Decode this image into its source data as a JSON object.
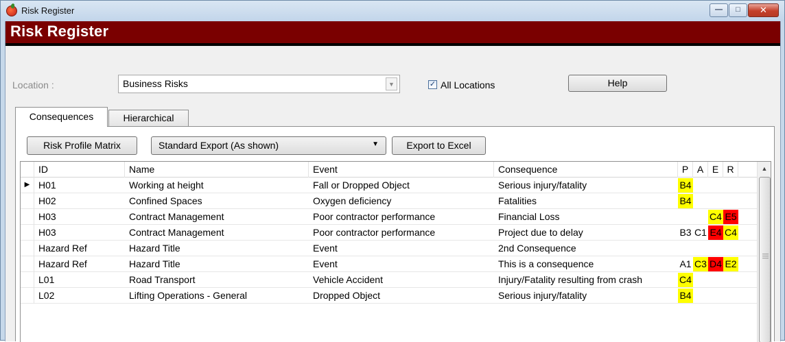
{
  "window": {
    "title": "Risk Register"
  },
  "header": {
    "title": "Risk Register"
  },
  "location": {
    "label": "Location :",
    "value": "Business Risks",
    "all_locations_label": "All Locations",
    "all_locations_checked": true
  },
  "help_label": "Help",
  "tabs": [
    {
      "label": "Consequences",
      "active": true
    },
    {
      "label": "Hierarchical",
      "active": false
    }
  ],
  "toolbar": {
    "matrix_label": "Risk Profile Matrix",
    "export_option": "Standard Export (As shown)",
    "export_label": "Export to Excel"
  },
  "colors": {
    "yellow": "#ffff00",
    "red": "#ff0000",
    "header_band": "#7a0000"
  },
  "grid": {
    "columns": [
      "ID",
      "Name",
      "Event",
      "Consequence",
      "P",
      "A",
      "E",
      "R"
    ],
    "rows": [
      {
        "id": "H01",
        "name": "Working at height",
        "event": "Fall or Dropped Object",
        "consequence": "Serious injury/fatality",
        "p": {
          "v": "B4",
          "c": "yellow"
        },
        "a": {
          "v": "",
          "c": ""
        },
        "e": {
          "v": "",
          "c": ""
        },
        "r": {
          "v": "",
          "c": ""
        },
        "current": true
      },
      {
        "id": "H02",
        "name": "Confined Spaces",
        "event": "Oxygen deficiency",
        "consequence": "Fatalities",
        "p": {
          "v": "B4",
          "c": "yellow"
        },
        "a": {
          "v": "",
          "c": ""
        },
        "e": {
          "v": "",
          "c": ""
        },
        "r": {
          "v": "",
          "c": ""
        }
      },
      {
        "id": "H03",
        "name": "Contract Management",
        "event": "Poor contractor performance",
        "consequence": "Financial Loss",
        "p": {
          "v": "",
          "c": ""
        },
        "a": {
          "v": "",
          "c": ""
        },
        "e": {
          "v": "C4",
          "c": "yellow"
        },
        "r": {
          "v": "E5",
          "c": "red"
        }
      },
      {
        "id": "H03",
        "name": "Contract Management",
        "event": "Poor contractor performance",
        "consequence": "Project due to delay",
        "p": {
          "v": "B3",
          "c": ""
        },
        "a": {
          "v": "C1",
          "c": ""
        },
        "e": {
          "v": "E4",
          "c": "red"
        },
        "r": {
          "v": "C4",
          "c": "yellow"
        }
      },
      {
        "id": "Hazard Ref",
        "name": "Hazard Title",
        "event": "Event",
        "consequence": "2nd Consequence",
        "p": {
          "v": "",
          "c": ""
        },
        "a": {
          "v": "",
          "c": ""
        },
        "e": {
          "v": "",
          "c": ""
        },
        "r": {
          "v": "",
          "c": ""
        }
      },
      {
        "id": "Hazard Ref",
        "name": "Hazard Title",
        "event": "Event",
        "consequence": "This is a consequence",
        "p": {
          "v": "A1",
          "c": ""
        },
        "a": {
          "v": "C3",
          "c": "yellow"
        },
        "e": {
          "v": "D4",
          "c": "red"
        },
        "r": {
          "v": "E2",
          "c": "yellow"
        }
      },
      {
        "id": "L01",
        "name": "Road Transport",
        "event": "Vehicle Accident",
        "consequence": "Injury/Fatality resulting from crash",
        "p": {
          "v": "C4",
          "c": "yellow"
        },
        "a": {
          "v": "",
          "c": ""
        },
        "e": {
          "v": "",
          "c": ""
        },
        "r": {
          "v": "",
          "c": ""
        }
      },
      {
        "id": "L02",
        "name": "Lifting Operations - General",
        "event": "Dropped Object",
        "consequence": "Serious injury/fatality",
        "p": {
          "v": "B4",
          "c": "yellow"
        },
        "a": {
          "v": "",
          "c": ""
        },
        "e": {
          "v": "",
          "c": ""
        },
        "r": {
          "v": "",
          "c": ""
        }
      }
    ]
  }
}
